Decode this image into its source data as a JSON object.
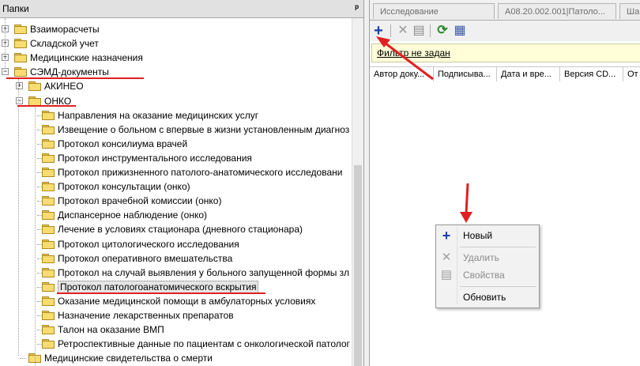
{
  "left_panel": {
    "title": "Папки",
    "pin_glyph": "ᴘ"
  },
  "tree": [
    {
      "label": "Взаиморасчеты",
      "level": 0,
      "expander": "+"
    },
    {
      "label": "Складской учет",
      "level": 0,
      "expander": "+"
    },
    {
      "label": "Медицинские назначения",
      "level": 0,
      "expander": "+"
    },
    {
      "label": "СЭМД-документы",
      "level": 0,
      "expander": "−"
    },
    {
      "label": "АКИНЕО",
      "level": 1,
      "expander": "+"
    },
    {
      "label": "ОНКО",
      "level": 1,
      "expander": "−"
    },
    {
      "label": "Направления на оказание медицинских услуг",
      "level": 2
    },
    {
      "label": "Извещение о больном с впервые в жизни установленным диагноз",
      "level": 2
    },
    {
      "label": "Протокол консилиума врачей",
      "level": 2
    },
    {
      "label": "Протокол инструментального исследования",
      "level": 2
    },
    {
      "label": "Протокол прижизненного патолого-анатомического исследовани",
      "level": 2
    },
    {
      "label": "Протокол консультации (онко)",
      "level": 2
    },
    {
      "label": "Протокол врачебной комиссии (онко)",
      "level": 2
    },
    {
      "label": "Диспансерное наблюдение (онко)",
      "level": 2
    },
    {
      "label": "Лечение в условиях стационара (дневного стационара)",
      "level": 2
    },
    {
      "label": "Протокол цитологического исследования",
      "level": 2
    },
    {
      "label": "Протокол оперативного вмешательства",
      "level": 2
    },
    {
      "label": "Протокол на случай выявления у больного запущенной формы зл",
      "level": 2
    },
    {
      "label": "Протокол патологоанатомического вскрытия",
      "level": 2,
      "selected": true
    },
    {
      "label": "Оказание медицинской помощи в амбулаторных условиях",
      "level": 2
    },
    {
      "label": "Назначение лекарственных препаратов",
      "level": 2
    },
    {
      "label": "Талон на оказание ВМП",
      "level": 2
    },
    {
      "label": "Ретроспективные данные по пациентам с онкологической патолог",
      "level": 2
    },
    {
      "label": "Медицинские свидетельства о смерти",
      "level": 1
    }
  ],
  "tabs": [
    {
      "label": "Исследование"
    },
    {
      "label": "A08.20.002.001|Патоло..."
    },
    {
      "label": "Шаб"
    }
  ],
  "toolbar": {
    "add": "+",
    "delete": "✕",
    "properties": "▤",
    "refresh": "⟳",
    "export": "▦"
  },
  "filter": {
    "text": "Фильтр не задан"
  },
  "grid_columns": [
    {
      "label": "Автор доку..."
    },
    {
      "label": "Подписыва..."
    },
    {
      "label": "Дата и вре..."
    },
    {
      "label": "Версия СD..."
    },
    {
      "label": "От"
    }
  ],
  "context_menu": {
    "items": [
      {
        "label": "Новый",
        "icon": "+",
        "enabled": true
      },
      {
        "label": "Удалить",
        "icon": "✕",
        "enabled": false
      },
      {
        "label": "Свойства",
        "icon": "▤",
        "enabled": false
      },
      {
        "label": "Обновить",
        "icon": "",
        "enabled": true
      }
    ]
  },
  "colors": {
    "annotation_red": "#e02020",
    "filter_bg": "#fffed8",
    "add_icon_blue": "#1c3fa8"
  }
}
